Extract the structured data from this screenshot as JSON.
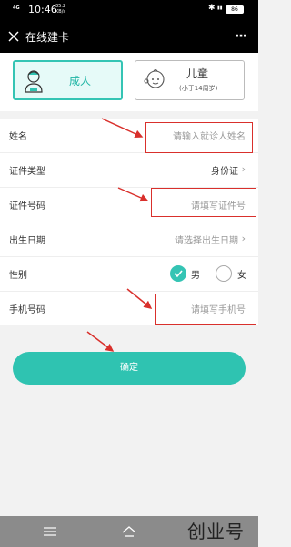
{
  "status_bar": {
    "signal": "4G",
    "time": "10:46",
    "speed": "35.2 KB/s",
    "battery": "86"
  },
  "header": {
    "title": "在线建卡"
  },
  "patient_types": [
    {
      "label": "成人"
    },
    {
      "label": "儿童",
      "sublabel": "(小于14周岁)"
    }
  ],
  "form": {
    "name": {
      "label": "姓名",
      "placeholder": "请输入就诊人姓名"
    },
    "id_type": {
      "label": "证件类型",
      "value": "身份证"
    },
    "id_number": {
      "label": "证件号码",
      "placeholder": "请填写证件号"
    },
    "birth_date": {
      "label": "出生日期",
      "placeholder": "请选择出生日期"
    },
    "gender": {
      "label": "性别",
      "options": [
        "男",
        "女"
      ],
      "selected": "男"
    },
    "phone": {
      "label": "手机号码",
      "placeholder": "请填写手机号"
    }
  },
  "confirm_label": "确定",
  "watermark": "创业号",
  "colors": {
    "accent": "#2fc3b1",
    "annotation": "#d9302c"
  }
}
